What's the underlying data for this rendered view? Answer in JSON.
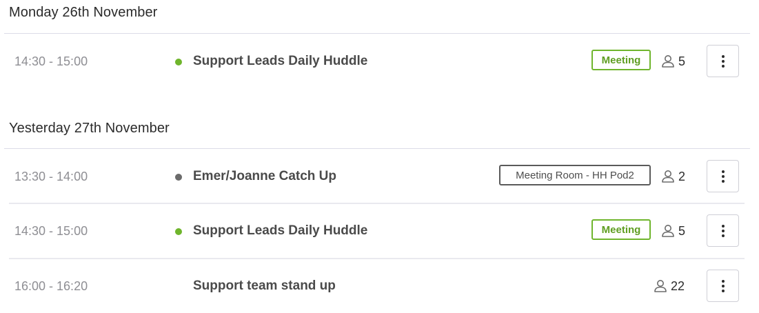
{
  "days": [
    {
      "header": "Monday 26th November",
      "events": [
        {
          "time": "14:30 - 15:00",
          "status_color": "#6fb52c",
          "title": "Support Leads Daily Huddle",
          "tag": "Meeting",
          "attendees": "5"
        }
      ]
    },
    {
      "header": "Yesterday 27th November",
      "events": [
        {
          "time": "13:30 - 14:00",
          "status_color": "#6b6b6b",
          "title": "Emer/Joanne Catch Up",
          "tag": "Meeting Room - HH Pod2",
          "attendees": "2"
        },
        {
          "time": "14:30 - 15:00",
          "status_color": "#6fb52c",
          "title": "Support Leads Daily Huddle",
          "tag": "Meeting",
          "attendees": "5"
        },
        {
          "time": "16:00 - 16:20",
          "status_color": "",
          "title": "Support team stand up",
          "tag": "",
          "attendees": "22"
        }
      ]
    }
  ],
  "icons": {
    "attendees": "person-outline-icon",
    "menu": "kebab-menu-icon"
  }
}
